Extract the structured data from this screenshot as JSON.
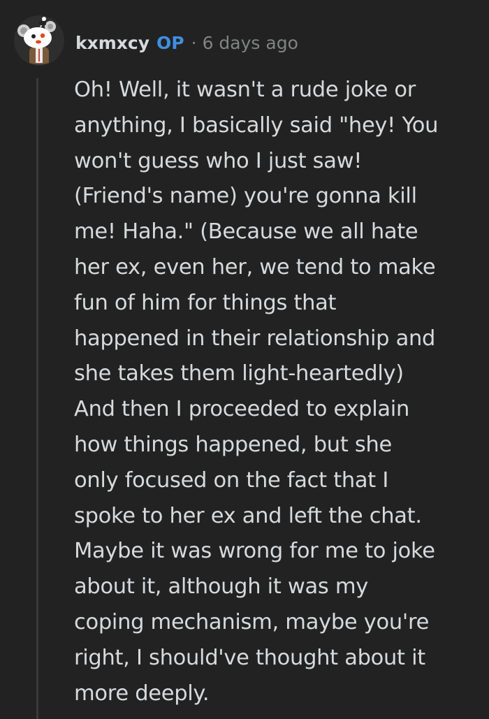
{
  "comment": {
    "author": "kxmxcy",
    "op_badge": "OP",
    "separator": "·",
    "timestamp": "6 days ago",
    "avatar_icon": "snoo-avatar-icon",
    "body_lines": [
      "Oh! Well, it wasn't a rude joke or",
      "anything, I basically said \"hey! You",
      "won't guess who I just saw!",
      "(Friend's name) you're gonna kill",
      "me! Haha.\" (Because we all hate",
      "her ex, even her, we tend to make",
      "fun of him for things that",
      "happened in their relationship and",
      "she takes them light-heartedly)",
      "And then I proceeded to explain",
      "how things happened, but she",
      "only focused on the fact that I",
      "spoke to her ex and left the chat.",
      "Maybe it was wrong for me to joke",
      "about it, although it was my",
      "coping mechanism, maybe you're",
      "right, I should've thought about it",
      "more deeply."
    ]
  },
  "colors": {
    "background": "#222222",
    "text": "#d7dadc",
    "muted": "#818384",
    "op_accent": "#3f8fe0",
    "thread_line": "#3a3a3a"
  }
}
